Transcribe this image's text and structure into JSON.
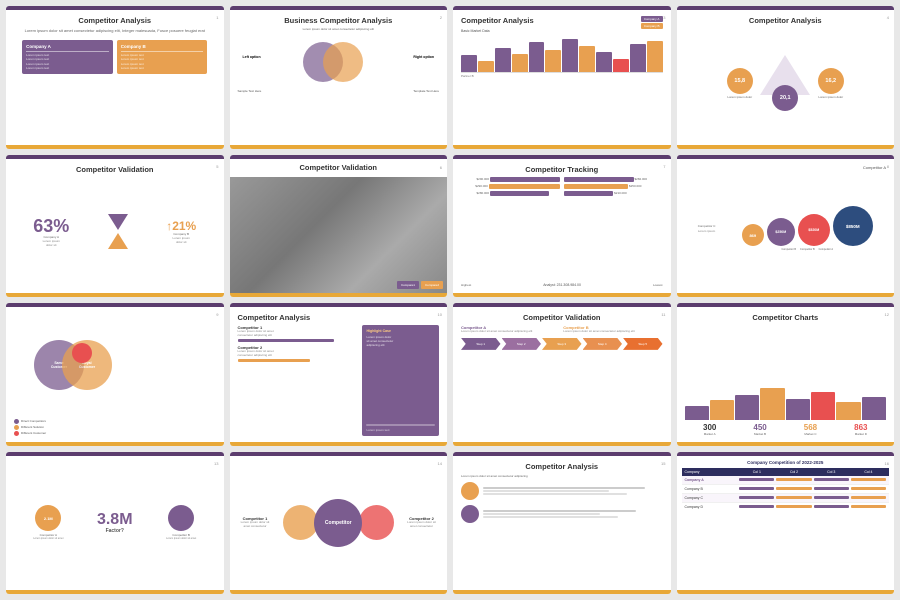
{
  "slides": [
    {
      "id": 1,
      "title": "Competitor Analysis",
      "subtitle": "Lorem ipsum dolor sit amet consectetur adipiscing elit, Integer malesuada, Fusce posuere feugiat erat",
      "company_a": "Company A",
      "company_b": "Company B",
      "box_a_lines": [
        "Lorem ipsum text",
        "Lorem ipsum text",
        "Lorem ipsum text",
        "Lorem ipsum text"
      ],
      "box_b_lines": [
        "Lorem ipsum text",
        "Lorem ipsum text",
        "Lorem ipsum text",
        "Lorem ipsum text"
      ]
    },
    {
      "id": 2,
      "title": "Business Competitor Analysis",
      "subtitle": "Lorem ipsum dolor sit amet consectetur adipiscing elit",
      "left_label": "Left option",
      "right_label": "Right option",
      "text_left": "Sample Text Here",
      "text_right": "Template Text Here"
    },
    {
      "id": 3,
      "title": "Competitor Analysis",
      "company_a_label": "Company A",
      "company_b_label": "Company B",
      "chart_label": "Basic Market Data",
      "partner_label": "Partner B"
    },
    {
      "id": 4,
      "title": "Competitor Analysis",
      "num1": "15,8",
      "num2": "16,2",
      "num3": "20,1"
    },
    {
      "id": 5,
      "title": "Competitor Validation",
      "percent1": "63%",
      "percent2": "↑21%",
      "company_a": "Company A",
      "company_b": "Company B"
    },
    {
      "id": 6,
      "title": "Competitor Validation",
      "tag1": "Compare1",
      "tag2": "Compare2"
    },
    {
      "id": 7,
      "title": "Competitor Tracking",
      "values": [
        "$290.000",
        "$290.000",
        "$280.000"
      ],
      "values2": [
        "$282.000",
        "$250.000",
        "$210.000"
      ],
      "labels": [
        "Highest",
        "Average",
        "Lowest"
      ]
    },
    {
      "id": 8,
      "title": "Competitor A",
      "bubbles": [
        {
          "label": "869",
          "size": 22,
          "color": "#e8a050"
        },
        {
          "label": "$250M",
          "size": 28,
          "color": "#7b5c8f"
        },
        {
          "label": "$520M",
          "size": 32,
          "color": "#e85050"
        },
        {
          "label": "$850M",
          "size": 38,
          "color": "#2d5c8f"
        }
      ],
      "bubble_labels": [
        "Competitor A",
        "Competitor B",
        "Competitor C",
        "Competitor D"
      ]
    },
    {
      "id": 9,
      "title": "",
      "circle1_label": "Same Customer",
      "circle2_label": "Loyal Customer",
      "legend": [
        "Direct Competitors",
        "Different Solution",
        "Different Customer"
      ]
    },
    {
      "id": 10,
      "title": "Competitor Analysis",
      "comp1": "Competitor 1",
      "comp2": "Competitor 2",
      "desc": "Lorem ipsum dolor sit amet",
      "highlight": "Highlight Case"
    },
    {
      "id": 11,
      "title": "Competitor Validation",
      "comp_a": "Competitor A",
      "comp_b": "Competitor B",
      "arrow_labels": [
        "Step 1",
        "Step 2",
        "Step 3",
        "Step 4",
        "Step 5"
      ]
    },
    {
      "id": 12,
      "title": "Competitor Charts",
      "markets": [
        "Market A",
        "Market B",
        "Market C",
        "Market D"
      ],
      "values": [
        "300",
        "450",
        "568",
        "863"
      ]
    },
    {
      "id": 13,
      "title": "",
      "stat1": "2.1M",
      "stat2": "3.8M",
      "label1": "Competitor A",
      "label2": "Factor?",
      "label3": "Competitor B",
      "sub1": "Lorem ipsum dolor sit amet",
      "sub2": "Lorem ipsum dolor sit amet"
    },
    {
      "id": 14,
      "title": "",
      "comp1": "Competitor 1",
      "comp2": "Competitor 2",
      "main_label": "Competitor",
      "desc1": "Lorem ipsum dolor sit amet consectetur",
      "desc2": "Lorem ipsum dolor sit amet consectetur"
    },
    {
      "id": 15,
      "title": "Competitor Analysis",
      "subtitle2": "Lorem ipsum dolor sit amet consectetur adipiscing",
      "icon1_color": "#e8a050",
      "icon2_color": "#7b5c8f"
    },
    {
      "id": 16,
      "title": "Company Competition of 2022-2025",
      "headers": [
        "Company",
        "Col 1",
        "Col 2",
        "Col 3",
        "Col 4"
      ],
      "rows": [
        [
          "Company A",
          "████",
          "███",
          "█████",
          "████"
        ],
        [
          "Company B",
          "██",
          "████",
          "███",
          "█████"
        ],
        [
          "Company C",
          "████",
          "██",
          "████",
          "███"
        ],
        [
          "Company D",
          "███",
          "█████",
          "██",
          "████"
        ]
      ]
    }
  ]
}
